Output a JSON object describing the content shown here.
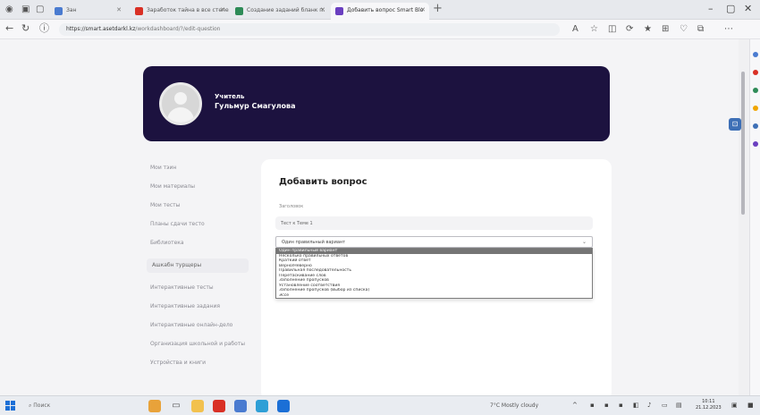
{
  "browser": {
    "tabs": [
      {
        "label": "Зан",
        "color": "#4a7bd0",
        "active": false
      },
      {
        "label": "Заработок тайна в все степе",
        "color": "#d93025",
        "active": false
      },
      {
        "label": "Создание заданий бланк п.",
        "color": "#2e8b57",
        "active": false
      },
      {
        "label": "Добавить вопрос Smart Blo",
        "color": "#6a3fc0",
        "active": true
      }
    ],
    "url_host": "https://smart.asetdarkl.kz",
    "url_path": "/workdashboard/?/edit-question",
    "new_tab": "+"
  },
  "header": {
    "role": "Учитель",
    "name": "Гульмур Смагулова"
  },
  "sidebar": {
    "items": [
      {
        "label": "Мои тэин",
        "active": false
      },
      {
        "label": "Мои материалы",
        "active": false
      },
      {
        "label": "Мои тесты",
        "active": false
      },
      {
        "label": "Планы сдачи тесто",
        "active": false
      },
      {
        "label": "Библиотека",
        "active": false
      },
      {
        "label": "Ашкабн турщеры",
        "active": true
      },
      {
        "label": "Интерактивные тесты",
        "active": false
      },
      {
        "label": "Интерактивные задания",
        "active": false
      },
      {
        "label": "Интерактивные онлайн-дело",
        "active": false
      },
      {
        "label": "Организация школьной и работы",
        "active": false
      },
      {
        "label": "Устройства и книги",
        "active": false
      }
    ]
  },
  "form": {
    "title": "Добавить вопрос",
    "test_label": "Заголовок",
    "test_value": "Тест к Теме 1",
    "type_selected": "Один правильный вариант",
    "caret": "⌄",
    "type_options": [
      "Один правильный вариант",
      "Несколько правильных ответов",
      "Краткий ответ",
      "Верно/Неверно",
      "Правильная последовательность",
      "Перетаскивание слов",
      "Заполнение пропусков",
      "Установление соответствия",
      "Заполнение пропусков (Выбор из списка)",
      "Эссе"
    ],
    "selected_index": 0
  },
  "taskbar": {
    "search_placeholder": "Поиск",
    "weather": "7°C Mostly cloudy",
    "time": "10:11",
    "date": "21.12.2023"
  },
  "colors": {
    "header_bg": "#1c123f",
    "selected_option_bg": "#757575",
    "badge_blue": "#3d6fb6"
  }
}
